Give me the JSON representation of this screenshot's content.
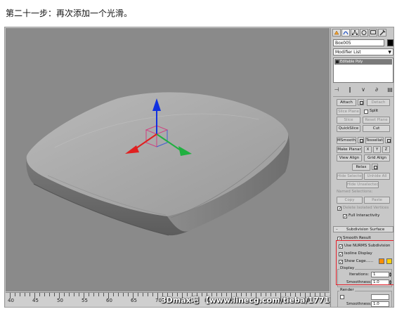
{
  "caption": "第二十一步：再次添加一个光滑。",
  "object_name": "Box005",
  "modifier_list_label": "Modifier List",
  "modifier_stack": [
    "Editable Poly"
  ],
  "edit_geometry": {
    "attach": "Attach",
    "detach": "Detach",
    "slice_plane": "Slice Plane",
    "split": "Split",
    "slice": "Slice",
    "reset_plane": "Reset Plane",
    "quickslice": "QuickSlice",
    "cut": "Cut",
    "msmooth": "MSmooth",
    "tessellate": "Tessellate",
    "make_planar": "Make Planar",
    "x": "X",
    "y": "Y",
    "z": "Z",
    "view_align": "View Align",
    "grid_align": "Grid Align",
    "relax": "Relax",
    "hide_selected": "Hide Selected",
    "unhide_all": "Unhide All",
    "hide_unselected": "Hide Unselected",
    "named_selections": "Named Selections:",
    "copy": "Copy",
    "paste": "Paste",
    "delete_isolated": "Delete Isolated Vertices",
    "full_interactivity": "Full Interactivity"
  },
  "subdivision": {
    "title": "Subdivision Surface",
    "smooth_result": "Smooth Result",
    "use_nurms": "Use NURMS Subdivision",
    "isoline_display": "Isoline Display",
    "show_cage": "Show Cage......",
    "cage_colors": [
      "#ff8c00",
      "#ffd000"
    ],
    "display_group": "Display",
    "iterations_label": "Iterations:",
    "iterations_value": "1",
    "smoothness_label": "Smoothness:",
    "smoothness_value": "1.0",
    "render_group": "Render",
    "render_smoothness_label": "Smoothness:",
    "render_smoothness_value": "1.0"
  },
  "timeline": {
    "ticks": [
      "40",
      "45",
      "50",
      "55",
      "60",
      "65",
      "70",
      "75",
      "80",
      "85",
      "90",
      "95",
      "100"
    ]
  },
  "watermark": "3Dmax吧 【www.linecg.com/tieba/1771】",
  "colors": {
    "viewport_bg": "#8a8a8a",
    "axis_x": "#e02020",
    "axis_y": "#20b040",
    "axis_z": "#1030e0",
    "highlight": "#e4202a"
  }
}
